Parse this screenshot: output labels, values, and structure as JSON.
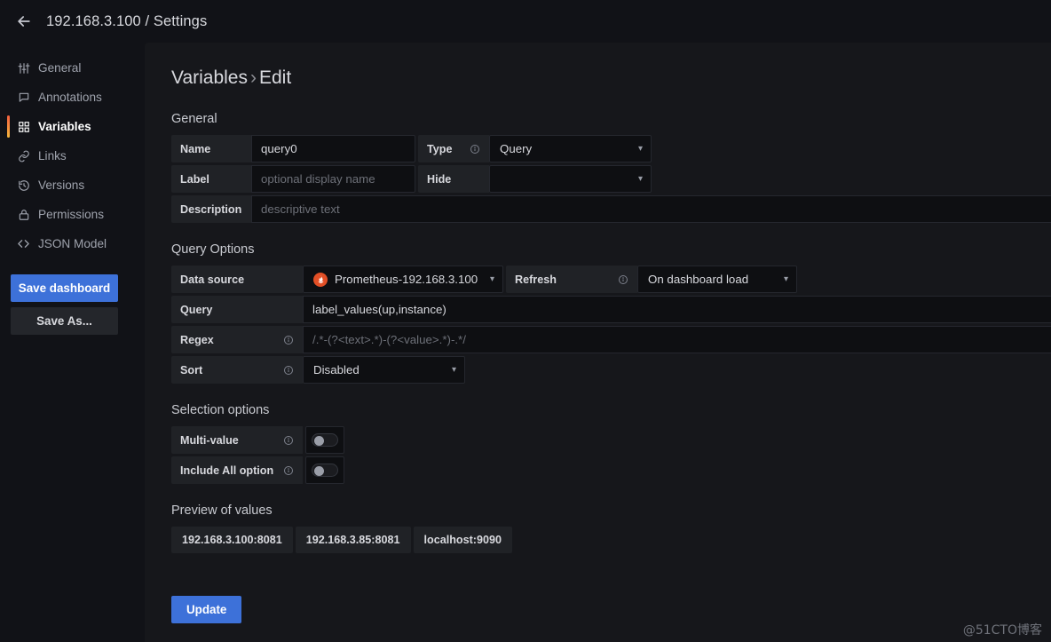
{
  "topbar": {
    "back_icon": "back-arrow-icon",
    "title": "192.168.3.100 / Settings"
  },
  "sidebar": {
    "items": [
      {
        "label": "General",
        "icon": "sliders-icon"
      },
      {
        "label": "Annotations",
        "icon": "comment-icon"
      },
      {
        "label": "Variables",
        "icon": "grid-icon"
      },
      {
        "label": "Links",
        "icon": "link-icon"
      },
      {
        "label": "Versions",
        "icon": "history-icon"
      },
      {
        "label": "Permissions",
        "icon": "lock-icon"
      },
      {
        "label": "JSON Model",
        "icon": "code-icon"
      }
    ],
    "active_index": 2,
    "save_dashboard_label": "Save dashboard",
    "save_as_label": "Save As...",
    "accent_top": "#f55f3e",
    "accent_bottom": "#f5b73d",
    "primary_color": "#3d71d9"
  },
  "page": {
    "title_main": "Variables",
    "title_sep": "›",
    "title_sub": "Edit"
  },
  "general": {
    "heading": "General",
    "name_label": "Name",
    "name_value": "query0",
    "type_label": "Type",
    "type_value": "Query",
    "label_label": "Label",
    "label_placeholder": "optional display name",
    "hide_label": "Hide",
    "hide_value": "",
    "description_label": "Description",
    "description_placeholder": "descriptive text"
  },
  "query_options": {
    "heading": "Query Options",
    "datasource_label": "Data source",
    "datasource_value": "Prometheus-192.168.3.100",
    "datasource_icon": "prometheus-logo-icon",
    "datasource_color": "#e24f26",
    "refresh_label": "Refresh",
    "refresh_value": "On dashboard load",
    "query_label": "Query",
    "query_value": "label_values(up,instance)",
    "regex_label": "Regex",
    "regex_placeholder": "/.*-(?<text>.*)-(?<value>.*)-.*/",
    "sort_label": "Sort",
    "sort_value": "Disabled"
  },
  "selection_options": {
    "heading": "Selection options",
    "multi_value_label": "Multi-value",
    "multi_value_on": false,
    "include_all_label": "Include All option",
    "include_all_on": false
  },
  "preview": {
    "heading": "Preview of values",
    "values": [
      "192.168.3.100:8081",
      "192.168.3.85:8081",
      "localhost:9090"
    ]
  },
  "actions": {
    "update_label": "Update"
  },
  "watermark": {
    "text": "@51CTO博客"
  }
}
